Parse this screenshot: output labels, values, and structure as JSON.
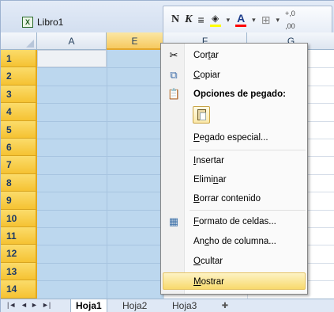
{
  "window": {
    "title": "Libro1",
    "doc_icon_glyph": "X"
  },
  "minitoolbar": {
    "bold": "N",
    "italic": "K",
    "align": "≡",
    "fill_color_icon": "fill-color-icon",
    "font_color": "A",
    "borders_icon": "borders-icon",
    "decimal": "+,0",
    "decimal2": ",00"
  },
  "columns": [
    "A",
    "E",
    "F",
    "G"
  ],
  "rows": [
    "1",
    "2",
    "3",
    "4",
    "5",
    "6",
    "7",
    "8",
    "9",
    "10",
    "11",
    "12",
    "13",
    "14"
  ],
  "context_menu": {
    "cut": {
      "pre": "Cor",
      "key": "t",
      "post": "ar"
    },
    "copy": {
      "pre": "",
      "key": "C",
      "post": "opiar"
    },
    "paste_options": "Opciones de pegado:",
    "paste_special": {
      "pre": "",
      "key": "P",
      "post": "egado especial..."
    },
    "insert": {
      "pre": "",
      "key": "I",
      "post": "nsertar"
    },
    "delete": {
      "pre": "Elimi",
      "key": "n",
      "post": "ar"
    },
    "clear": {
      "pre": "",
      "key": "B",
      "post": "orrar contenido"
    },
    "format_cells": {
      "pre": "",
      "key": "F",
      "post": "ormato de celdas..."
    },
    "column_width": {
      "pre": "An",
      "key": "c",
      "post": "ho de columna..."
    },
    "hide": {
      "pre": "",
      "key": "O",
      "post": "cultar"
    },
    "unhide": {
      "pre": "",
      "key": "M",
      "post": "ostrar"
    }
  },
  "sheet_tabs": {
    "nav": [
      "|◄",
      "◄",
      "►",
      "►|"
    ],
    "tabs": [
      "Hoja1",
      "Hoja2",
      "Hoja3"
    ],
    "active": "Hoja1",
    "new_sheet_icon": "new-sheet-icon"
  },
  "colors": {
    "selection": "#bcd7ee",
    "row_header_selected": "#f5c232",
    "menu_hover": "#f8d96c"
  }
}
